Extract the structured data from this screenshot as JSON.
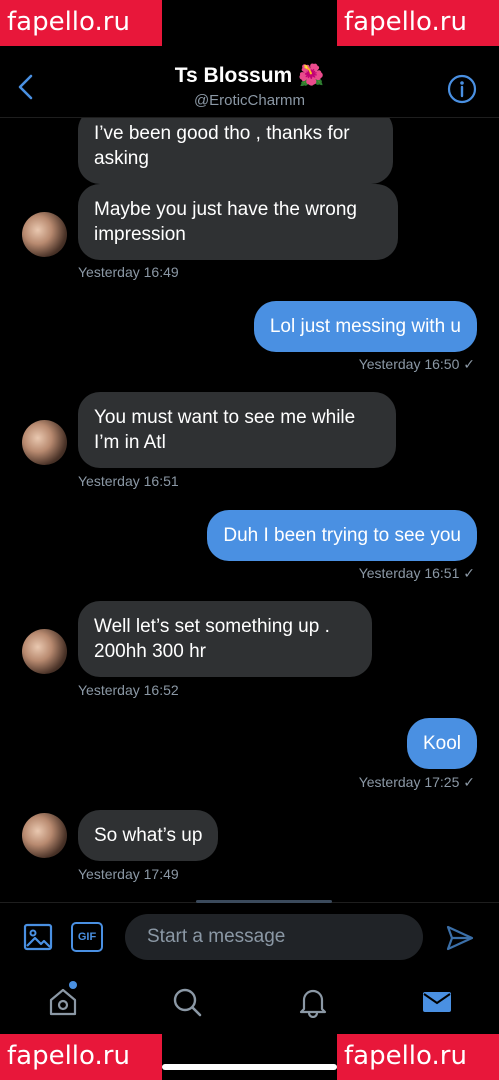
{
  "watermarks": [
    "fapello.ru",
    "fapello.ru",
    "fapello.ru",
    "fapello.ru"
  ],
  "header": {
    "title": "Ts Blossum 🌺",
    "handle": "@EroticCharmm"
  },
  "messages": [
    {
      "dir": "in",
      "text": "I’ve been good tho , thanks for asking"
    },
    {
      "dir": "in",
      "text": "Maybe you just have the wrong impression"
    },
    {
      "dir": "in_ts",
      "text": "Yesterday 16:49"
    },
    {
      "dir": "out",
      "text": "Lol just messing with u"
    },
    {
      "dir": "out_ts",
      "text": "Yesterday 16:50 ✓"
    },
    {
      "dir": "in",
      "text": "You must want to see me while I’m in Atl"
    },
    {
      "dir": "in_ts",
      "text": "Yesterday 16:51"
    },
    {
      "dir": "out",
      "text": "Duh I been trying to see you"
    },
    {
      "dir": "out_ts",
      "text": "Yesterday 16:51 ✓"
    },
    {
      "dir": "in",
      "text": "Well let’s set something up . 200hh 300 hr"
    },
    {
      "dir": "in_ts",
      "text": "Yesterday 16:52"
    },
    {
      "dir": "out",
      "text": "Kool"
    },
    {
      "dir": "out_ts",
      "text": "Yesterday 17:25 ✓"
    },
    {
      "dir": "in",
      "text": "So what’s up"
    },
    {
      "dir": "in_ts",
      "text": "Yesterday 17:49"
    }
  ],
  "composer": {
    "placeholder": "Start a message",
    "gif_label": "GIF"
  },
  "icons": {
    "back": "chevron-left-icon",
    "info": "info-icon",
    "image": "image-icon",
    "send": "send-icon",
    "home": "home-icon",
    "search": "search-icon",
    "notifications": "bell-icon",
    "messages": "mail-icon"
  },
  "colors": {
    "accent": "#4a90e2",
    "incoming_bubble": "#2f3133",
    "background": "#000000",
    "muted_text": "#8b98a5"
  }
}
